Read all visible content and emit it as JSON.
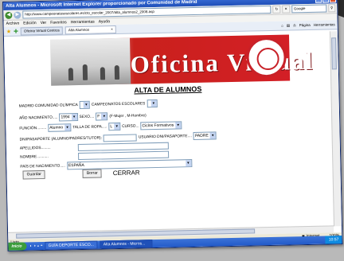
{
  "window": {
    "title": "Alta Alumnos - Microsoft Internet Explorer proporcionado por Comunidad de Madrid",
    "url": "http://www.campeonatosescolares.es/cto_escolar_2007/alta_alumnos2_2008.asp",
    "search_placeholder": "Google"
  },
  "menu": [
    "Archivo",
    "Edición",
    "Ver",
    "Favoritos",
    "Herramientas",
    "Ayuda"
  ],
  "tabs": [
    {
      "label": "Oficina Virtual Centros"
    },
    {
      "label": "Alta Alumnos"
    }
  ],
  "toolbar": {
    "page_label": "Página",
    "tools_label": "Herramientas"
  },
  "banner": {
    "logo_text": "Oficina Virtual"
  },
  "form": {
    "title": "ALTA DE ALUMNOS",
    "madrid_label": "MADRID COMUNIDAD OLÍMPICA",
    "campeonatos_label": "CAMPEONATOS ESCOLARES",
    "ano_label": "AÑO NACIMIENTO.....",
    "ano_value": "1994",
    "sexo_label": "SEXO....",
    "sexo_value": "F",
    "sexo_hint": "(F-Mujer , M-Hombre)",
    "funcion_label": "FUNCIÓN.........",
    "funcion_value": "Alumno",
    "talla_label": "TALLA DE ROPA.....",
    "talla_value": "L",
    "curso_label": "CURSO...",
    "curso_value": "Ciclos Formativos",
    "dni_label": "DNI/PASAPORTE (ALUMNO/PADRES/TUTOR):",
    "usuario_label": "USUARIO DNI/PASAPORTE....",
    "usuario_value": "PADRE",
    "apellidos_label": "APELLIDOS.........",
    "nombre_label": "NOMBRE...........",
    "pais_label": "PAÍS DE NACIMIENTO.....",
    "pais_value": "ESPAÑA",
    "guardar_label": "Guardar",
    "borrar_label": "Borrar",
    "cerrar_label": "CERRAR"
  },
  "status": {
    "left": "Listo",
    "zone": "Internet",
    "zoom": "100%"
  },
  "taskbar": {
    "start": "Inicio",
    "items": [
      "GUÍA DEPORTE ESCO...",
      "Alta Alumnos - Micros..."
    ],
    "clock": "10:57"
  }
}
